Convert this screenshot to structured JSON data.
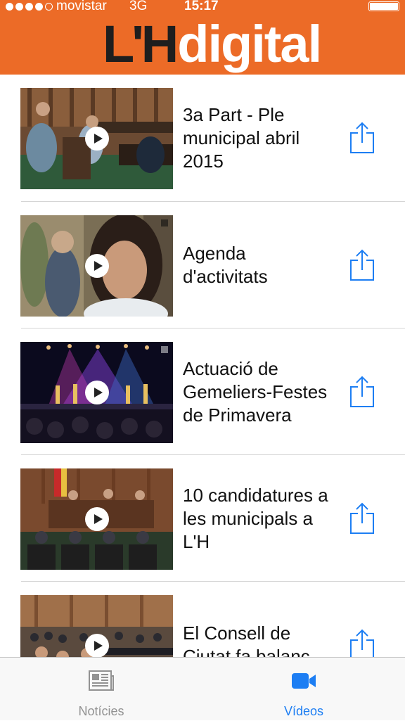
{
  "status_bar": {
    "carrier": "movistar",
    "network": "3G",
    "time": "15:17"
  },
  "header": {
    "logo_main": "L'H",
    "logo_accent": "digital"
  },
  "videos": [
    {
      "title": "3a Part - Ple municipal abril 2015"
    },
    {
      "title": "Agenda d'activitats"
    },
    {
      "title": "Actuació de Gemeliers-Festes de Primavera"
    },
    {
      "title": "10 candidatures a les municipals a L'H"
    },
    {
      "title": "El Consell de Ciutat fa balanç"
    }
  ],
  "tab_bar": {
    "tabs": [
      {
        "label": "Notícies",
        "icon": "newspaper-icon",
        "selected": false
      },
      {
        "label": "Vídeos",
        "icon": "video-camera-icon",
        "selected": true
      }
    ]
  },
  "colors": {
    "header": "#ec6b27",
    "accent": "#1d7ef3",
    "inactive": "#929292"
  }
}
